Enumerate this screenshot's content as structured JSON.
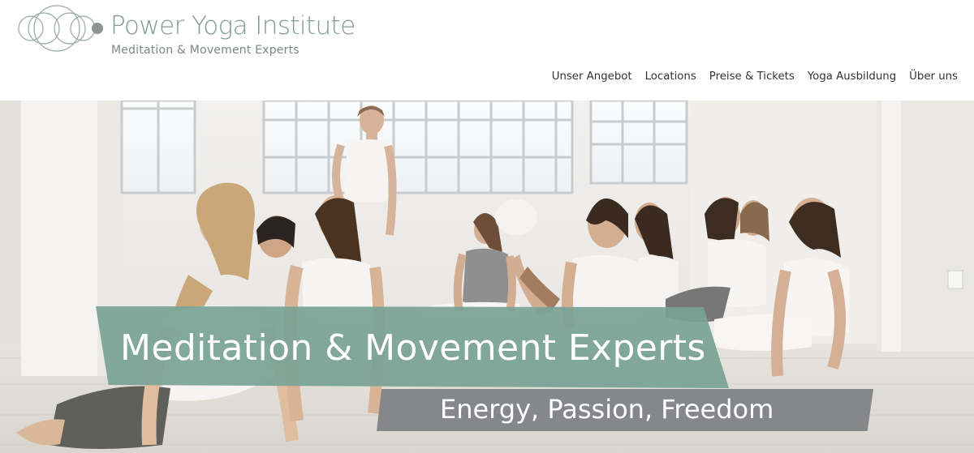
{
  "brand": {
    "title": "Power Yoga Institute",
    "subtitle": "Meditation & Movement Experts",
    "logo_icon": "interlocking-circles-logo",
    "color": "#7f9b93"
  },
  "nav": {
    "items": [
      {
        "label": "Unser Angebot"
      },
      {
        "label": "Locations"
      },
      {
        "label": "Preise & Tickets"
      },
      {
        "label": "Yoga Ausbildung"
      },
      {
        "label": "Über uns"
      }
    ]
  },
  "hero": {
    "image": "yoga-class-upward-dog-photo",
    "headline": "Meditation & Movement Experts",
    "tagline": "Energy, Passion, Freedom",
    "headline_bg": "#7aa296",
    "tagline_bg": "#7d8084"
  }
}
